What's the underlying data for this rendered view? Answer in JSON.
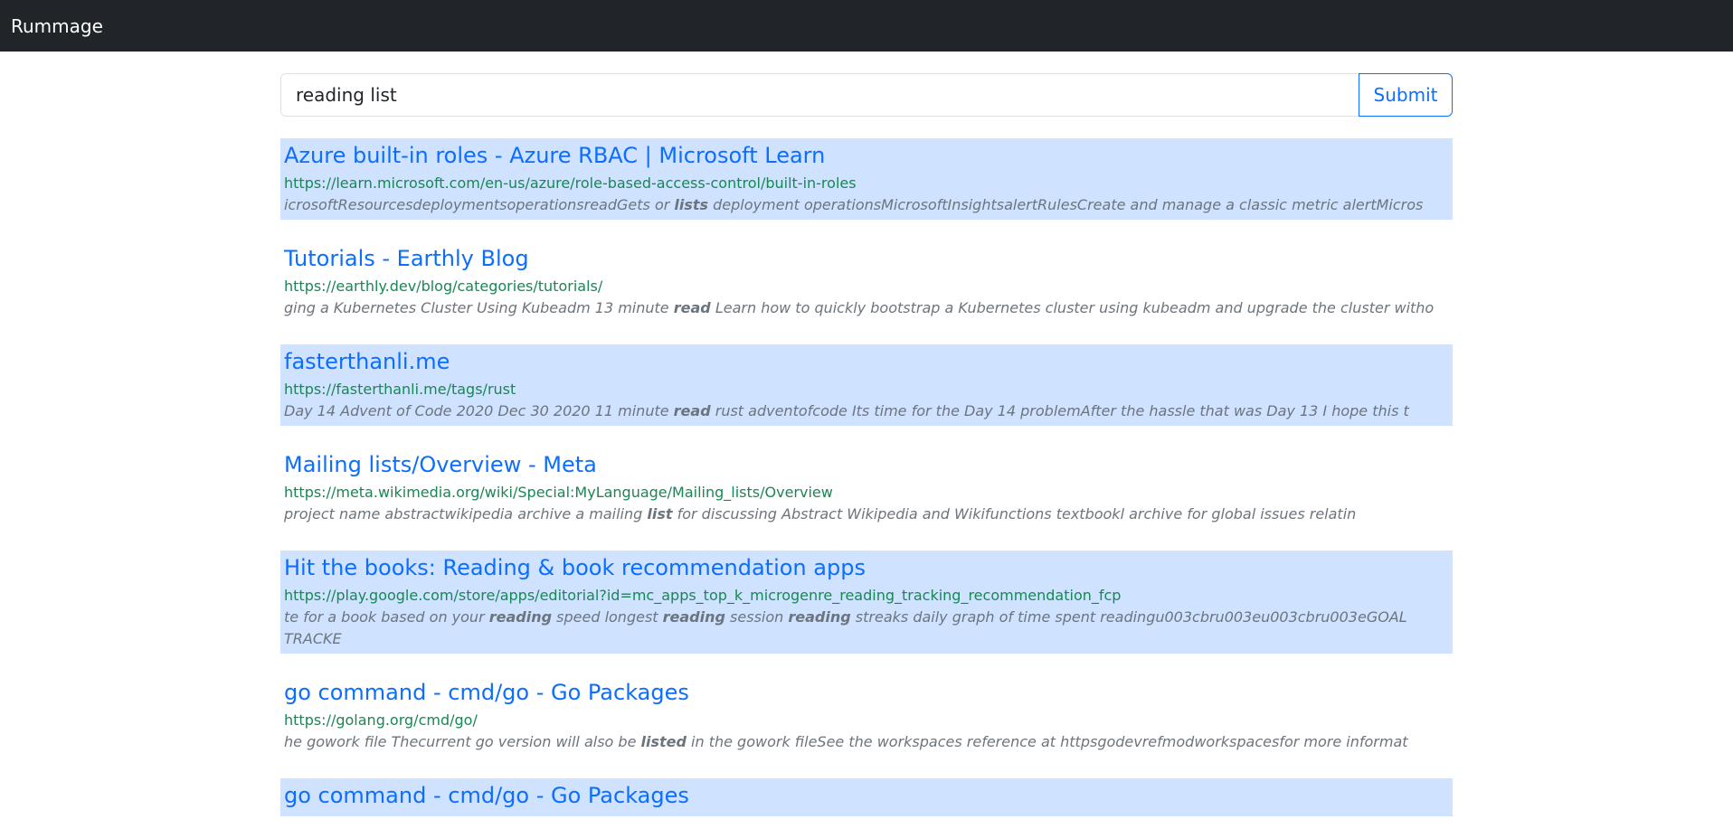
{
  "navbar": {
    "brand": "Rummage"
  },
  "search": {
    "value": "reading list",
    "submit_label": "Submit"
  },
  "results": [
    {
      "title": "Azure built-in roles - Azure RBAC | Microsoft Learn",
      "url": "https://learn.microsoft.com/en-us/azure/role-based-access-control/built-in-roles",
      "highlighted": true,
      "snippet": [
        {
          "t": "icrosoftResourcesdeploymentsoperationsreadGets or ",
          "b": false
        },
        {
          "t": "lists",
          "b": true
        },
        {
          "t": " deployment operationsMicrosoftInsightsalertRulesCreate and manage a classic metric alertMicros",
          "b": false
        }
      ]
    },
    {
      "title": "Tutorials - Earthly Blog",
      "url": "https://earthly.dev/blog/categories/tutorials/",
      "highlighted": false,
      "snippet": [
        {
          "t": "ging a Kubernetes Cluster Using Kubeadm 13 minute ",
          "b": false
        },
        {
          "t": "read",
          "b": true
        },
        {
          "t": " Learn how to quickly bootstrap a Kubernetes cluster using kubeadm and upgrade the cluster witho",
          "b": false
        }
      ]
    },
    {
      "title": "fasterthanli.me",
      "url": "https://fasterthanli.me/tags/rust",
      "highlighted": true,
      "snippet": [
        {
          "t": "Day 14 Advent of Code 2020 Dec 30 2020 11 minute ",
          "b": false
        },
        {
          "t": "read",
          "b": true
        },
        {
          "t": " rust adventofcode Its time for the Day 14 problemAfter the hassle that was Day 13 I hope this t",
          "b": false
        }
      ]
    },
    {
      "title": "Mailing lists/Overview - Meta",
      "url": "https://meta.wikimedia.org/wiki/Special:MyLanguage/Mailing_lists/Overview",
      "highlighted": false,
      "snippet": [
        {
          "t": "project name abstractwikipedia archive a mailing ",
          "b": false
        },
        {
          "t": "list",
          "b": true
        },
        {
          "t": " for discussing Abstract Wikipedia and Wikifunctions textbookl archive for global issues relatin",
          "b": false
        }
      ]
    },
    {
      "title": "Hit the books: Reading & book recommendation apps",
      "url": "https://play.google.com/store/apps/editorial?id=mc_apps_top_k_microgenre_reading_tracking_recommendation_fcp",
      "highlighted": true,
      "snippet": [
        {
          "t": "te for a book based on your ",
          "b": false
        },
        {
          "t": "reading",
          "b": true
        },
        {
          "t": " speed longest ",
          "b": false
        },
        {
          "t": "reading",
          "b": true
        },
        {
          "t": " session ",
          "b": false
        },
        {
          "t": "reading",
          "b": true
        },
        {
          "t": " streaks daily graph of time spent readingu003cbru003eu003cbru003eGOAL TRACKE",
          "b": false
        }
      ]
    },
    {
      "title": "go command - cmd/go - Go Packages",
      "url": "https://golang.org/cmd/go/",
      "highlighted": false,
      "snippet": [
        {
          "t": "he gowork file Thecurrent go version will also be ",
          "b": false
        },
        {
          "t": "listed",
          "b": true
        },
        {
          "t": " in the gowork fileSee the workspaces reference at httpsgodevrefmodworkspacesfor more informat",
          "b": false
        }
      ]
    },
    {
      "title": "go command - cmd/go - Go Packages",
      "url": "",
      "highlighted": true,
      "snippet": []
    }
  ]
}
